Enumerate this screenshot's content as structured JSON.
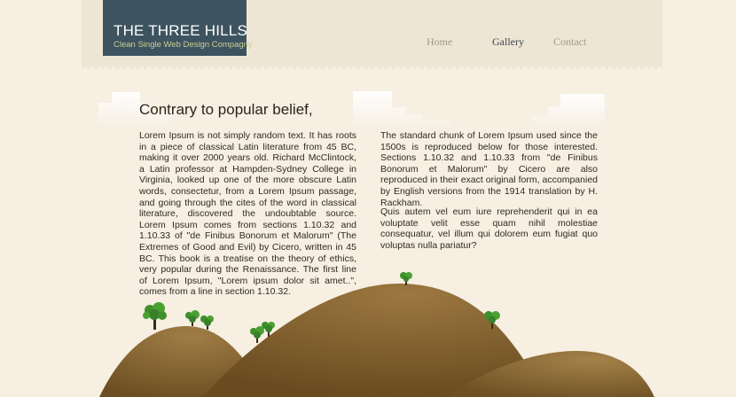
{
  "brand": {
    "title": "THE THREE HILLS",
    "tagline": "Clean Single Web Design Compagny"
  },
  "nav": {
    "items": [
      {
        "label": "Home",
        "active": false
      },
      {
        "label": "Gallery",
        "active": true
      },
      {
        "label": "Contact",
        "active": false
      }
    ]
  },
  "content": {
    "heading": "Contrary to popular belief,",
    "left_paragraph": "Lorem Ipsum is not simply random text. It has roots in a piece of classical Latin literature from 45 BC, making it over 2000 years old. Richard McClintock, a Latin professor at Hampden-Sydney College in Virginia, looked up one of the more obscure Latin words, consectetur, from a Lorem Ipsum passage, and going through the cites of the word in classical literature, discovered the undoubtable source. Lorem Ipsum comes from sections 1.10.32 and 1.10.33 of \"de Finibus Bonorum et Malorum\" (The Extremes of Good and Evil) by Cicero, written in 45 BC. This book is a treatise on the theory of ethics, very popular during the Renaissance. The first line of Lorem Ipsum, \"Lorem ipsum dolor sit amet..\", comes from a line in section 1.10.32.",
    "right_paragraph_1": "The standard chunk of Lorem Ipsum used since the 1500s is reproduced below for those interested. Sections 1.10.32 and 1.10.33 from \"de Finibus Bonorum et Malorum\" by Cicero are also reproduced in their exact original form, accompanied by English versions from the 1914 translation by H. Rackham.",
    "right_paragraph_2": "Quis autem vel eum iure reprehenderit qui in ea voluptate velit esse quam nihil molestiae consequatur, vel illum qui dolorem eum fugiat quo voluptas nulla pariatur?"
  },
  "theme": {
    "background": "#f6efe2",
    "header_band": "#eee6d4",
    "logo_box": "#3d5360",
    "tagline_color": "#c9cf8f",
    "hill_color": "#7a5a2c",
    "tree_color": "#3f8f2a"
  }
}
